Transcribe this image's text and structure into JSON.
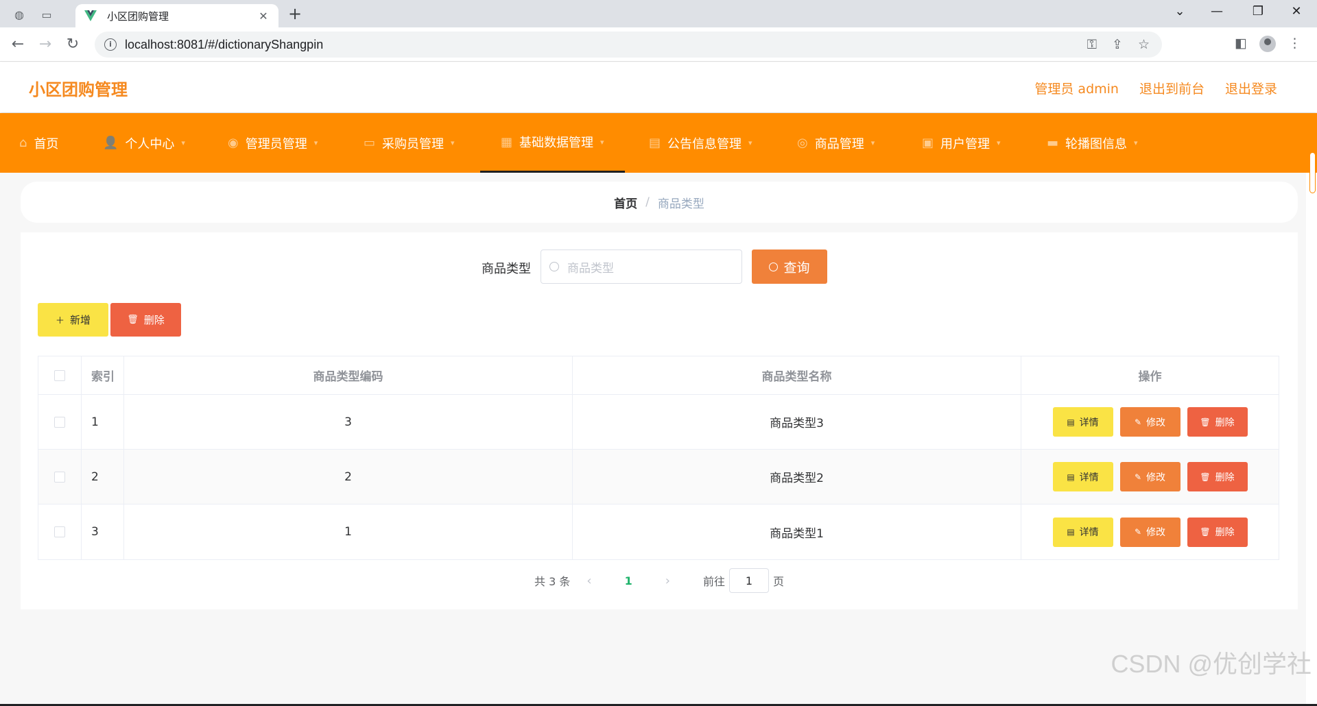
{
  "browser": {
    "tab_title": "小区团购管理",
    "tab_close": "✕",
    "new_tab": "+",
    "url": "localhost:8081/#/dictionaryShangpin",
    "win_min": "—",
    "win_restore": "❐",
    "win_close": "✕",
    "win_dropdown": "⌄"
  },
  "header": {
    "brand": "小区团购管理",
    "user": "管理员 admin",
    "to_front": "退出到前台",
    "logout": "退出登录"
  },
  "nav": {
    "items": [
      {
        "label": "首页",
        "icon": "home-icon",
        "glyph": "⌂"
      },
      {
        "label": "个人中心",
        "icon": "user-icon",
        "glyph": "👤"
      },
      {
        "label": "管理员管理",
        "icon": "location-icon",
        "glyph": "◉"
      },
      {
        "label": "采购员管理",
        "icon": "chat-icon",
        "glyph": "▭"
      },
      {
        "label": "基础数据管理",
        "icon": "grid-icon",
        "glyph": "▦"
      },
      {
        "label": "公告信息管理",
        "icon": "notebook-icon",
        "glyph": "▤"
      },
      {
        "label": "商品管理",
        "icon": "compass-icon",
        "glyph": "◎"
      },
      {
        "label": "用户管理",
        "icon": "suitcase-icon",
        "glyph": "▣"
      },
      {
        "label": "轮播图信息",
        "icon": "monitor-icon",
        "glyph": "▬"
      }
    ],
    "active_index": 4
  },
  "breadcrumb": {
    "home": "首页",
    "sep": "/",
    "current": "商品类型"
  },
  "search": {
    "label": "商品类型",
    "placeholder": "商品类型",
    "button": "查询"
  },
  "toolbar": {
    "add": "新增",
    "delete": "删除"
  },
  "table": {
    "columns": [
      "索引",
      "商品类型编码",
      "商品类型名称",
      "操作"
    ],
    "rows": [
      {
        "index": "1",
        "code": "3",
        "name": "商品类型3"
      },
      {
        "index": "2",
        "code": "2",
        "name": "商品类型2"
      },
      {
        "index": "3",
        "code": "1",
        "name": "商品类型1"
      }
    ],
    "ops": {
      "detail": "详情",
      "edit": "修改",
      "delete": "删除"
    }
  },
  "pagination": {
    "total": "共 3 条",
    "current_page": "1",
    "goto_label": "前往",
    "goto_value": "1",
    "page_unit": "页"
  },
  "watermark": "CSDN @优创学社",
  "colors": {
    "nav_bg": "#ff8c00",
    "brand": "#f5891f",
    "detail_btn": "#fae345",
    "edit_btn": "#f0813a",
    "delete_btn": "#ee6242",
    "page_active": "#1fb36b"
  }
}
